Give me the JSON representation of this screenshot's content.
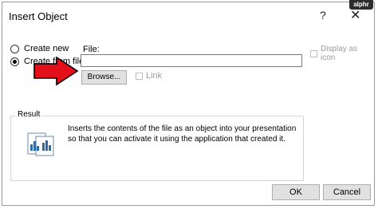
{
  "dialog": {
    "title": "Insert Object",
    "help_icon": "?",
    "close_icon": "✕"
  },
  "watermark": "alphr",
  "options": {
    "create_new": "Create new",
    "create_from_file": "Create from file",
    "selected": "create_from_file"
  },
  "file": {
    "label": "File:",
    "value": "",
    "browse_label": "Browse...",
    "link_label": "Link",
    "link_checked": false
  },
  "display_as_icon": {
    "label": "Display as icon",
    "checked": false
  },
  "result": {
    "label": "Result",
    "text": "Inserts the contents of the file as an object into your presentation so that you can activate it using the application that created it."
  },
  "buttons": {
    "ok": "OK",
    "cancel": "Cancel"
  },
  "colors": {
    "arrow_fill": "#e3101a",
    "arrow_outline": "#000000"
  },
  "icons": {
    "arrow": "red-pointer-arrow-icon",
    "result": "embedded-document-icon"
  }
}
